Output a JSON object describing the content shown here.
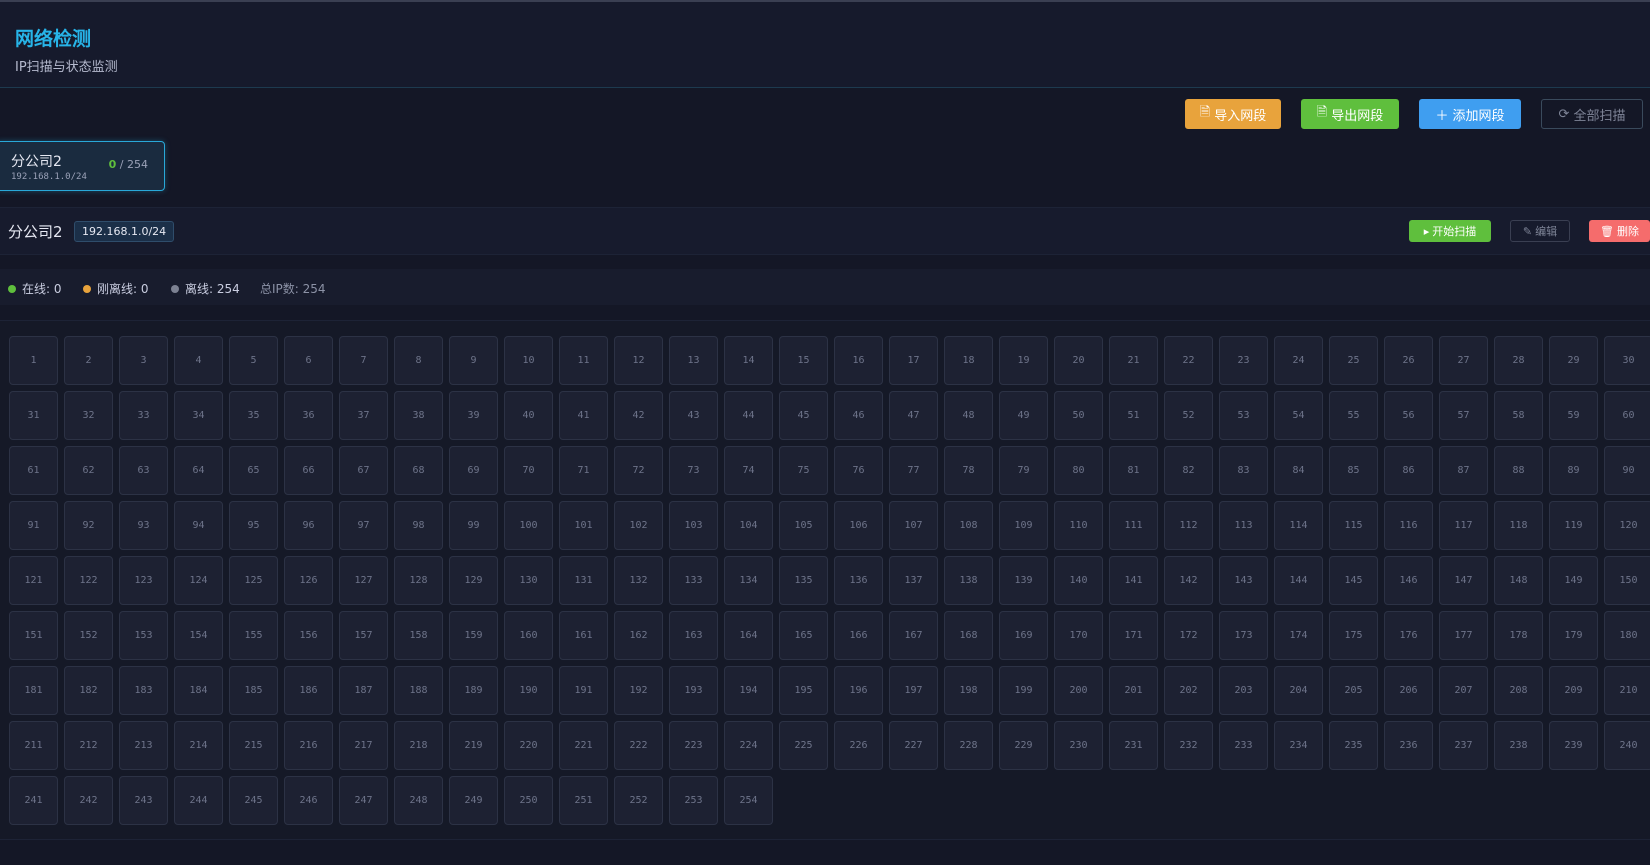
{
  "header": {
    "title": "网络检测",
    "subtitle": "IP扫描与状态监测"
  },
  "toolbar": {
    "import_label": "导入网段",
    "export_label": "导出网段",
    "add_label": "添加网段",
    "scan_all_label": "全部扫描"
  },
  "segments": [
    {
      "name": "分公司2",
      "cidr": "192.168.1.0/24",
      "online": "0",
      "total": "254"
    }
  ],
  "selected_segment": {
    "name": "分公司2",
    "cidr": "192.168.1.0/24",
    "start_scan_label": "开始扫描",
    "edit_label": "编辑",
    "delete_label": "删除",
    "stats": {
      "online": "在线: 0",
      "recent_offline": "刚离线: 0",
      "offline": "离线: 254",
      "total": "总IP数: 254"
    },
    "ip_count": 254,
    "columns": 30
  },
  "colors": {
    "accent": "#27b4e8",
    "online": "#5fbf3d",
    "recent_offline": "#e8a33c",
    "offline": "#7c8192",
    "danger": "#f56c6c",
    "primary": "#3f9ef0"
  }
}
